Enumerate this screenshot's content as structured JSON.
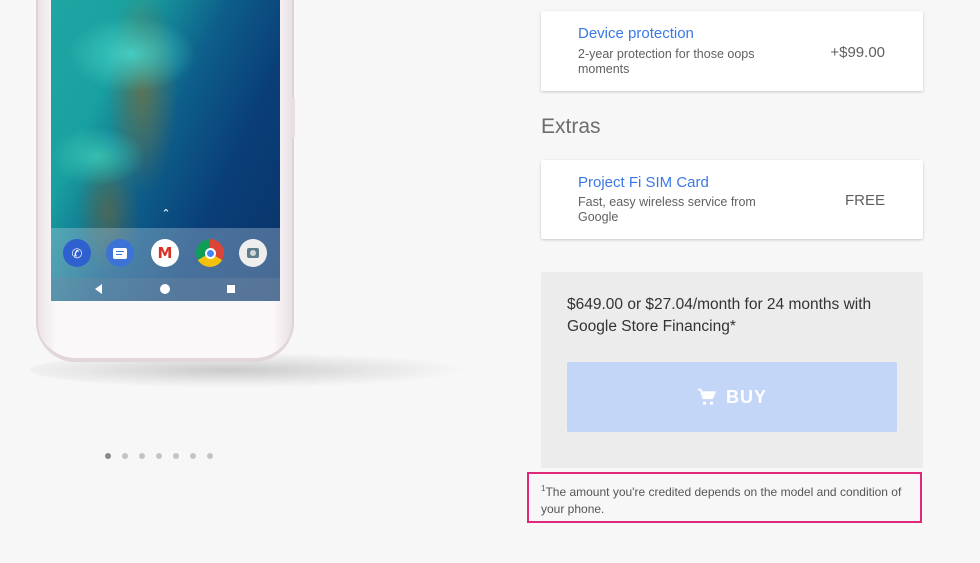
{
  "device_protection": {
    "title": "Device protection",
    "description": "2-year protection for those oops moments",
    "price": "+$99.00"
  },
  "extras": {
    "heading": "Extras",
    "sim_card": {
      "title": "Project Fi SIM Card",
      "description": "Fast, easy wireless service from Google",
      "price": "FREE"
    }
  },
  "purchase": {
    "price_text": "$649.00 or $27.04/month for 24 months with Google Store Financing*",
    "buy_label": "BUY",
    "buy_button_color": "#c3d6f7"
  },
  "footnote": {
    "marker": "1",
    "text": "The amount you're credited depends on the model and condition of your phone.",
    "highlight_color": "#e0287a"
  },
  "carousel": {
    "dot_count": 7,
    "active_index": 0
  },
  "phone_apps": [
    "phone-icon",
    "messages-icon",
    "gmail-icon",
    "chrome-icon",
    "camera-icon"
  ],
  "accent_color": "#3b78e7"
}
